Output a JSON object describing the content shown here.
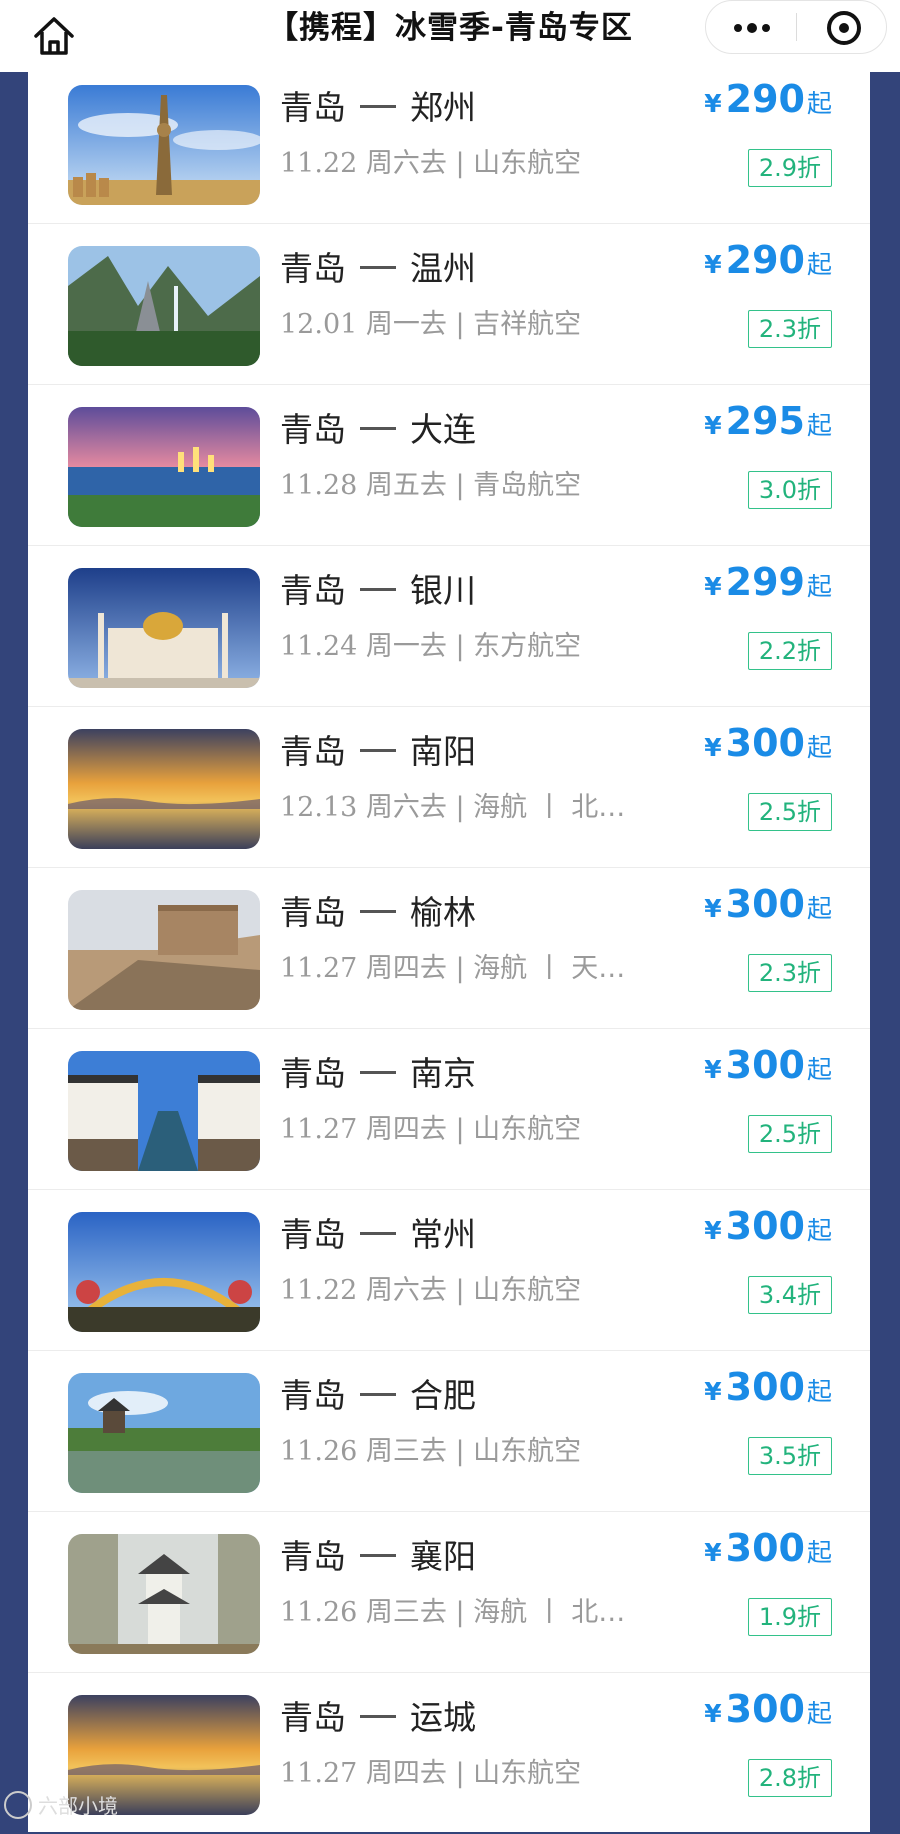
{
  "header": {
    "title": "【携程】冰雪季-青岛专区"
  },
  "flights": [
    {
      "from": "青岛",
      "to": "郑州",
      "date": "11.22",
      "info": " 周六去 | 山东航空",
      "price": "290",
      "discount": "2.9折",
      "scene": "tower"
    },
    {
      "from": "青岛",
      "to": "温州",
      "date": "12.01",
      "info": " 周一去 | 吉祥航空",
      "price": "290",
      "discount": "2.3折",
      "scene": "mountain"
    },
    {
      "from": "青岛",
      "to": "大连",
      "date": "11.28",
      "info": " 周五去 | 青岛航空",
      "price": "295",
      "discount": "3.0折",
      "scene": "coast"
    },
    {
      "from": "青岛",
      "to": "银川",
      "date": "11.24",
      "info": " 周一去 | 东方航空",
      "price": "299",
      "discount": "2.2折",
      "scene": "mosque"
    },
    {
      "from": "青岛",
      "to": "南阳",
      "date": "12.13",
      "info": " 周六去 | 海航 丨 北…",
      "price": "300",
      "discount": "2.5折",
      "scene": "sunset"
    },
    {
      "from": "青岛",
      "to": "榆林",
      "date": "11.27",
      "info": " 周四去 | 海航 丨 天…",
      "price": "300",
      "discount": "2.3折",
      "scene": "wall"
    },
    {
      "from": "青岛",
      "to": "南京",
      "date": "11.27",
      "info": " 周四去 | 山东航空",
      "price": "300",
      "discount": "2.5折",
      "scene": "canal"
    },
    {
      "from": "青岛",
      "to": "常州",
      "date": "11.22",
      "info": " 周六去 | 山东航空",
      "price": "300",
      "discount": "3.4折",
      "scene": "park"
    },
    {
      "from": "青岛",
      "to": "合肥",
      "date": "11.26",
      "info": " 周三去 | 山东航空",
      "price": "300",
      "discount": "3.5折",
      "scene": "lake"
    },
    {
      "from": "青岛",
      "to": "襄阳",
      "date": "11.26",
      "info": " 周三去 | 海航 丨 北…",
      "price": "300",
      "discount": "1.9折",
      "scene": "pavilion"
    },
    {
      "from": "青岛",
      "to": "运城",
      "date": "11.27",
      "info": " 周四去 | 山东航空",
      "price": "300",
      "discount": "2.8折",
      "scene": "sunset"
    }
  ],
  "labels": {
    "currency": "¥",
    "suffix": "起"
  },
  "icons": {
    "home": "home-icon",
    "more": "more-icon",
    "close": "target-icon"
  },
  "watermark": "六部小境",
  "colors": {
    "price": "#1a8be6",
    "discount": "#22b37c",
    "frame": "#33447a"
  }
}
